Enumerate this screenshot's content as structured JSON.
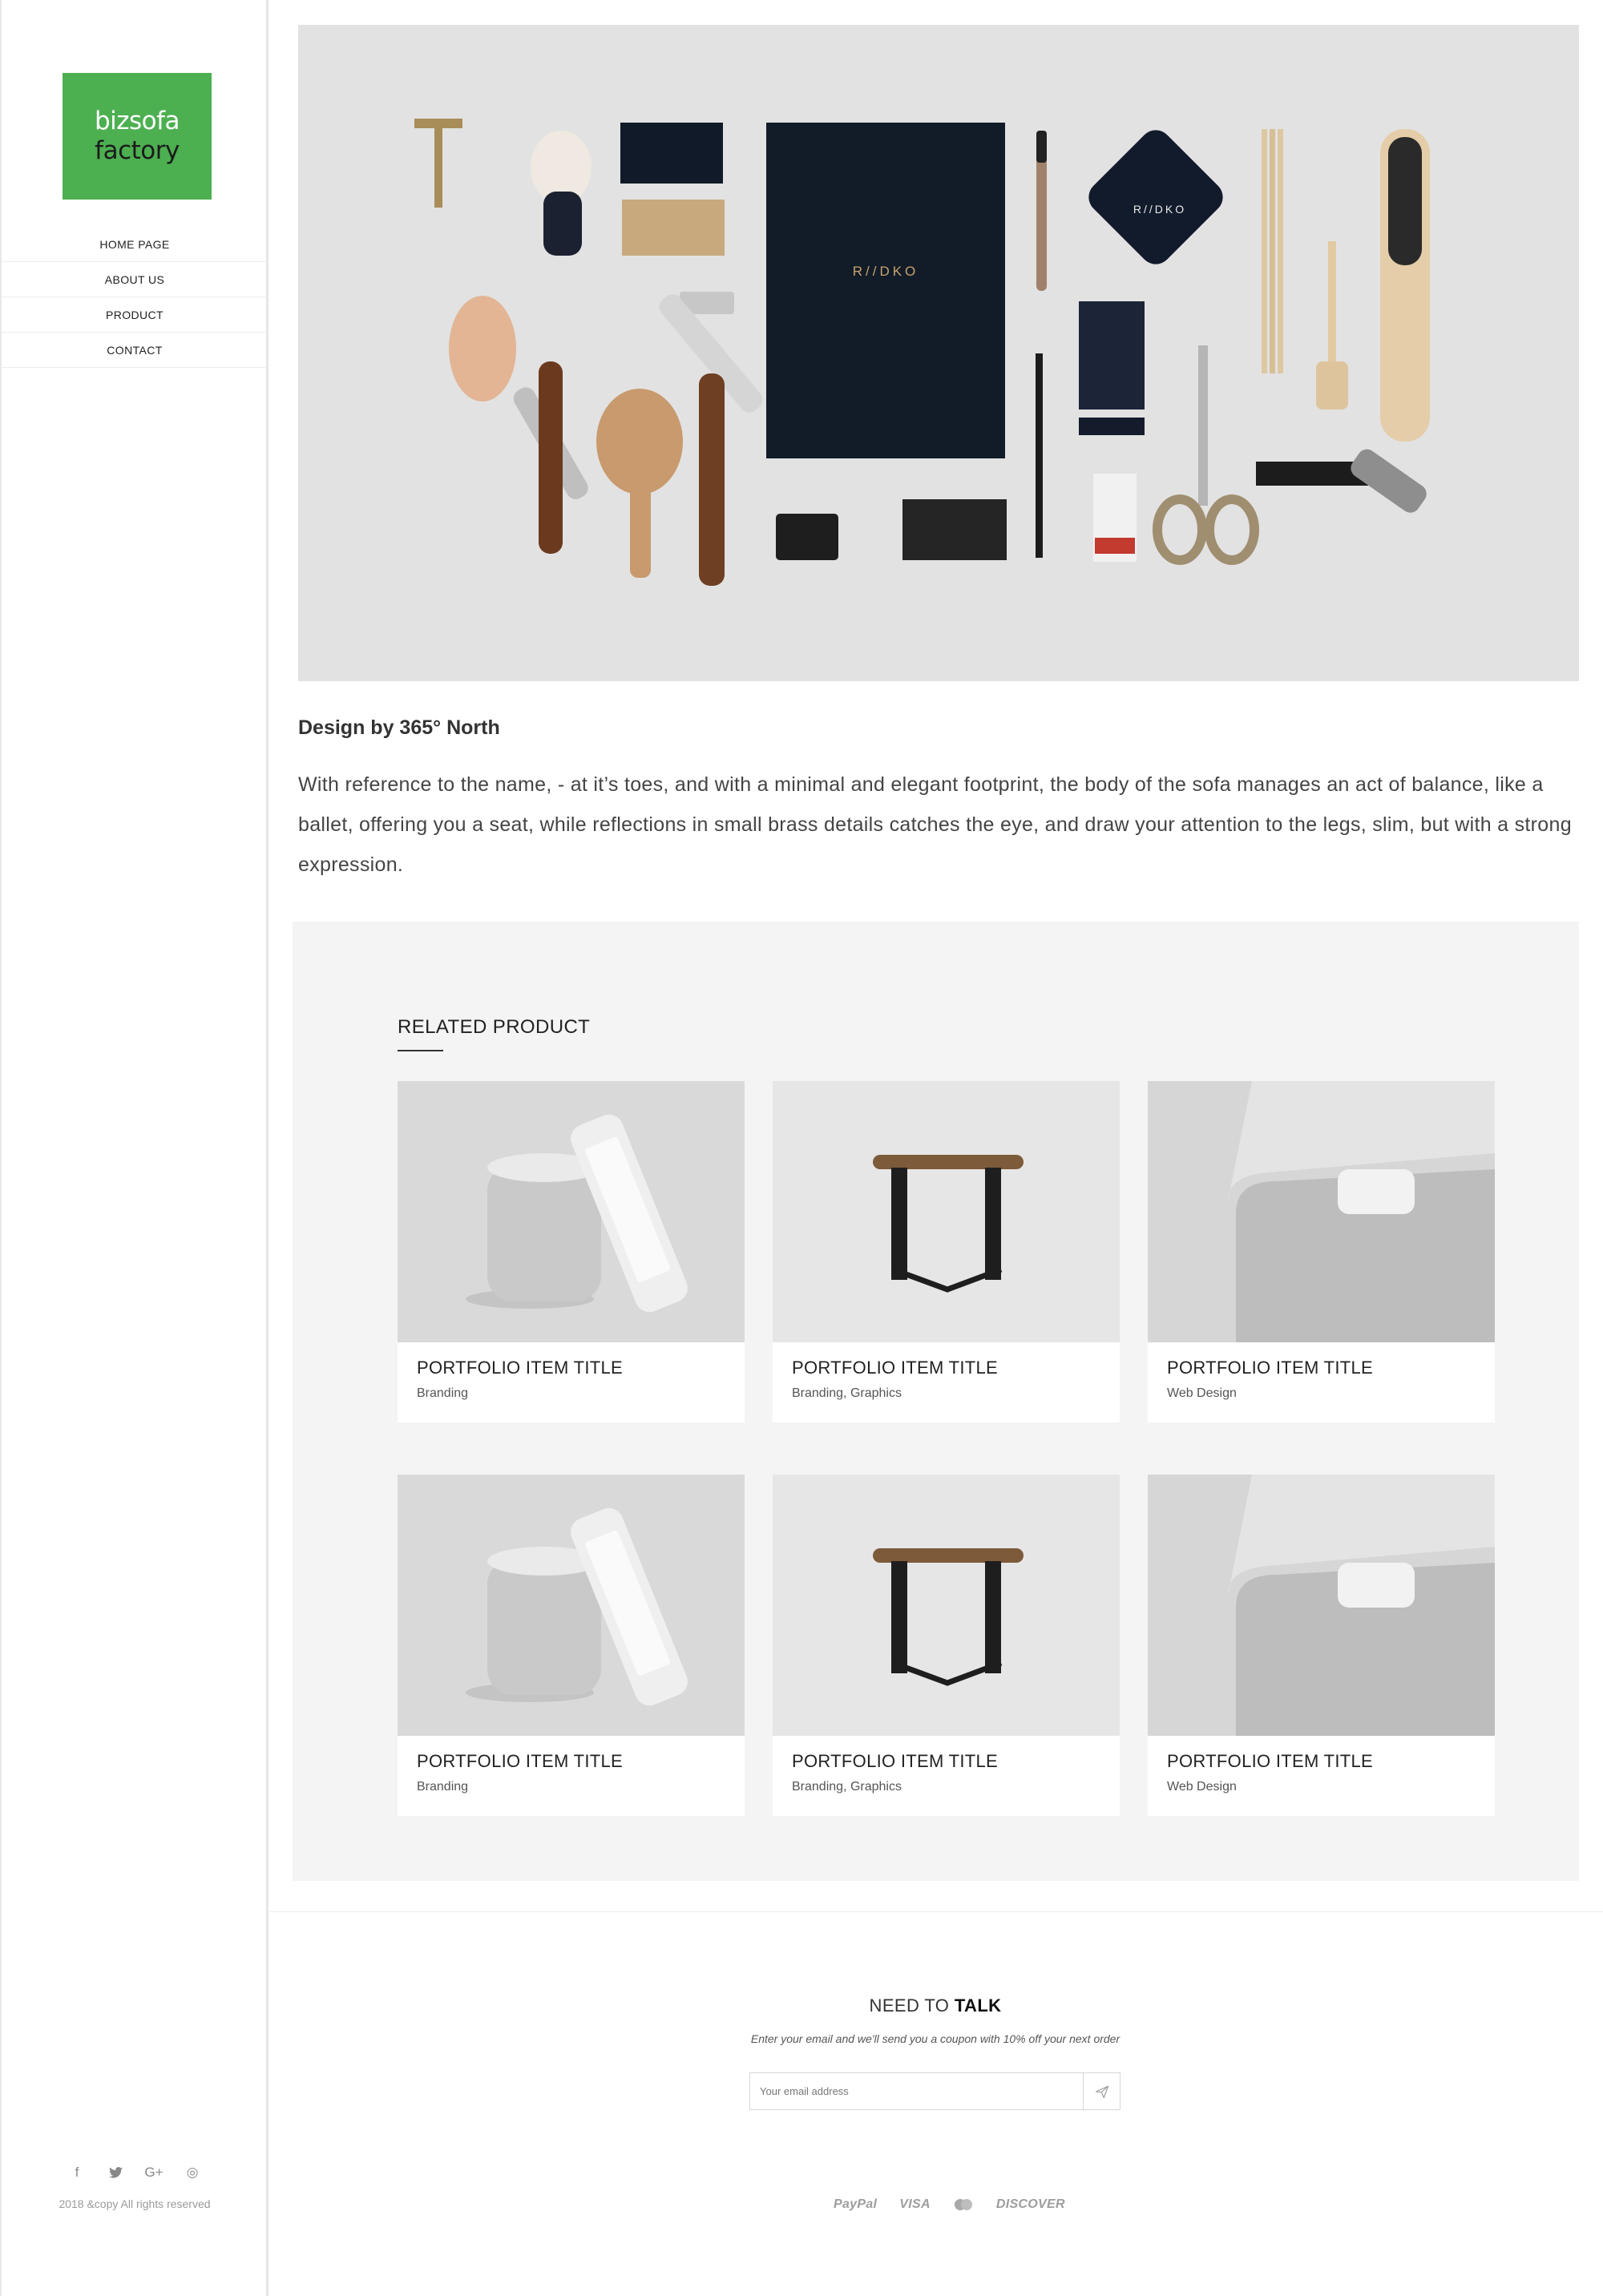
{
  "sidebar": {
    "logo": {
      "line1": "bizsofa",
      "line2": "factory",
      "bg_color": "#4caf50"
    },
    "nav": [
      {
        "label": "HOME PAGE"
      },
      {
        "label": "ABOUT US"
      },
      {
        "label": "PRODUCT"
      },
      {
        "label": "CONTACT"
      }
    ],
    "socials": [
      {
        "icon": "facebook-icon",
        "glyph": "f"
      },
      {
        "icon": "twitter-icon",
        "glyph": "t"
      },
      {
        "icon": "google-plus-icon",
        "glyph": "G+"
      },
      {
        "icon": "instagram-icon",
        "glyph": "◎"
      }
    ],
    "copyright": "2018 &copy All rights reserved"
  },
  "hero": {
    "brand_label": "R//DKO",
    "brand_label_small": "R//DKO"
  },
  "main": {
    "design_title": "Design by 365° North",
    "description": "With reference to the name, - at it’s toes, and with a minimal and elegant footprint, the body of the sofa manages an act of balance, like a ballet, offering you a seat, while reflections in small brass details catches the eye, and draw your attention to the legs, slim, but with a strong expression."
  },
  "related": {
    "title": "RELATED PRODUCT",
    "items": [
      {
        "title": "PORTFOLIO ITEM TITLE",
        "category": "Branding",
        "image": "speaker-phone"
      },
      {
        "title": "PORTFOLIO ITEM TITLE",
        "category": "Branding, Graphics",
        "image": "stool"
      },
      {
        "title": "PORTFOLIO ITEM TITLE",
        "category": "Web Design",
        "image": "device-top"
      },
      {
        "title": "PORTFOLIO ITEM TITLE",
        "category": "Branding",
        "image": "speaker-phone"
      },
      {
        "title": "PORTFOLIO ITEM TITLE",
        "category": "Branding, Graphics",
        "image": "stool"
      },
      {
        "title": "PORTFOLIO ITEM TITLE",
        "category": "Web Design",
        "image": "device-top"
      }
    ]
  },
  "footer": {
    "talk_prefix": "NEED TO ",
    "talk_bold": "TALK",
    "subtitle": "Enter your email and we'll send you a coupon with 10% off your next order",
    "email_placeholder": "Your email address",
    "payments": [
      "PayPal",
      "VISA",
      "DISCOVER"
    ]
  }
}
